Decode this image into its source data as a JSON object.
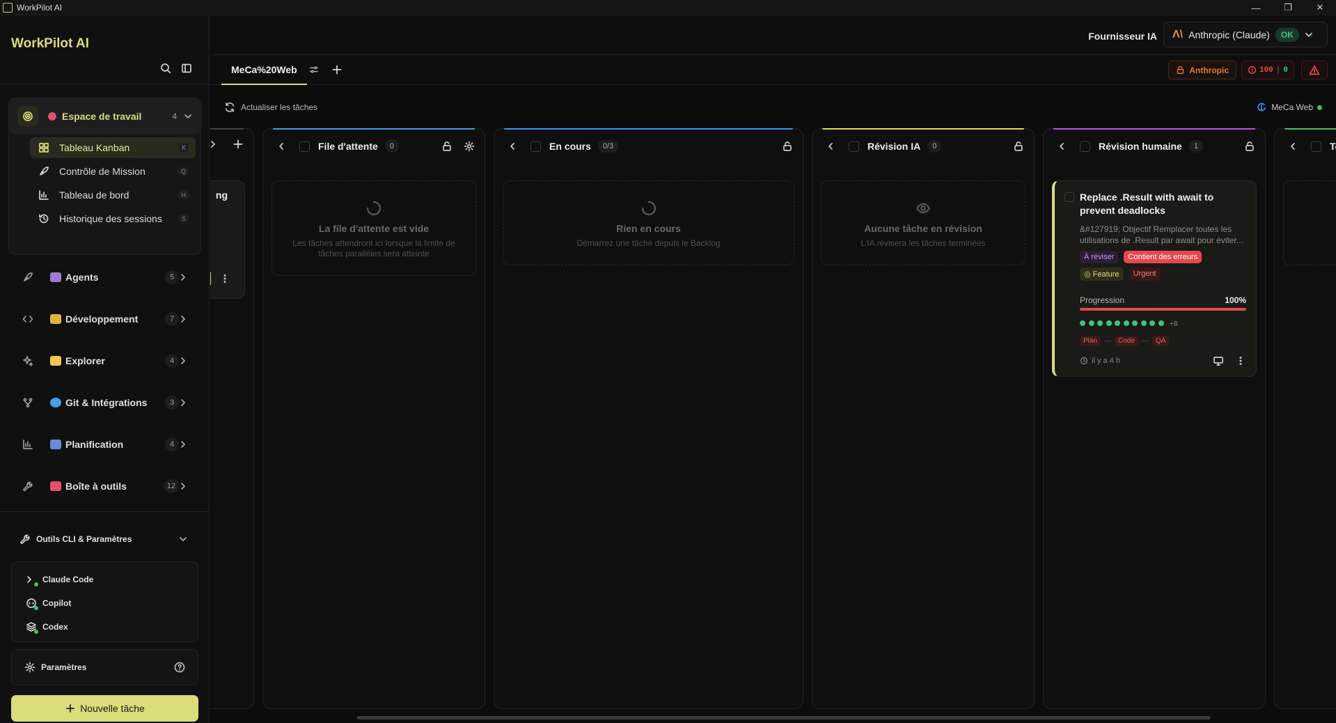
{
  "window": {
    "title": "WorkPilot AI",
    "controls": [
      "—",
      "❐",
      "✕"
    ]
  },
  "sidebar": {
    "brand": "WorkPilot AI",
    "workspace": {
      "label": "Espace de travail",
      "count": "4",
      "items": [
        {
          "label": "Tableau Kanban",
          "key": "K",
          "icon": "kanban-grid-icon",
          "active": true
        },
        {
          "label": "Contrôle de Mission",
          "key": "Q",
          "icon": "rocket-icon"
        },
        {
          "label": "Tableau de bord",
          "key": "H",
          "icon": "bar-chart-icon"
        },
        {
          "label": "Historique des sessions",
          "key": "S",
          "icon": "history-icon"
        }
      ]
    },
    "nav": [
      {
        "label": "Agents",
        "count": "5",
        "icon": "rocket-icon",
        "emoji_color": "#9a7ad6"
      },
      {
        "label": "Développement",
        "count": "7",
        "icon": "code-icon",
        "emoji_color": "#e2b33c"
      },
      {
        "label": "Explorer",
        "count": "4",
        "icon": "sparkles-icon",
        "emoji_color": "#f2c94c"
      },
      {
        "label": "Git & Intégrations",
        "count": "3",
        "icon": "git-branch-icon",
        "emoji_color": "#4a9fe0"
      },
      {
        "label": "Planification",
        "count": "4",
        "icon": "bar-chart-icon",
        "emoji_color": "#6a8ad8"
      },
      {
        "label": "Boîte à outils",
        "count": "12",
        "icon": "wrench-icon",
        "emoji_color": "#e0506a"
      }
    ],
    "cli": {
      "label": "Outils CLI & Paramètres",
      "items": [
        {
          "label": "Claude Code",
          "icon": "terminal-icon"
        },
        {
          "label": "Copilot",
          "icon": "copilot-icon"
        },
        {
          "label": "Codex",
          "icon": "layers-icon"
        }
      ]
    },
    "settings_label": "Paramètres",
    "new_task_label": "Nouvelle tâche"
  },
  "header": {
    "provider_label": "Fournisseur IA",
    "provider_name": "Anthropic (Claude)",
    "provider_status": "OK"
  },
  "tabs": {
    "active": "MeCa%20Web",
    "anthropic_badge": "Anthropic",
    "error_count": "100",
    "ok_count": "0"
  },
  "toolbar": {
    "refresh_label": "Actualiser les tâches",
    "project_name": "MeCa Web"
  },
  "board": {
    "partial_left_text": "ng",
    "queue": {
      "title": "File d'attente",
      "count": "0",
      "empty_title": "La file d'attente est vide",
      "empty_sub": "Les tâches attendront ici lorsque la limite de tâches parallèles sera atteinte"
    },
    "in_progress": {
      "title": "En cours",
      "count": "0/3",
      "empty_title": "Rien en cours",
      "empty_sub": "Démarrez une tâche depuis le Backlog"
    },
    "ai_review": {
      "title": "Révision IA",
      "count": "0",
      "empty_title": "Aucune tâche en révision",
      "empty_sub": "L'IA révisera les tâches terminées"
    },
    "human_review": {
      "title": "Révision humaine",
      "count": "1",
      "task": {
        "title": "Replace .Result with await to prevent deadlocks",
        "description": "&#127919; Objectif Remplacer toutes les utilisations de .Result par await pour éviter...",
        "tags": {
          "review": "À réviser",
          "errors": "Contient des erreurs",
          "feature": "Feature",
          "urgent": "Urgent"
        },
        "progress_label": "Progression",
        "progress_value": "100%",
        "progress": 1.0,
        "dots_count": 10,
        "dots_more": "+8",
        "phases": [
          "Plan",
          "Code",
          "QA"
        ],
        "time": "il y a 4 h"
      }
    },
    "next_partial_title": "Te"
  },
  "colors": {
    "accent": "#d9dd7a",
    "queue": "#3aa0e0",
    "in_progress": "#3a8ff0",
    "ai_review": "#d9dd4a",
    "human_review": "#c04ce0",
    "next": "#3ec26a"
  }
}
